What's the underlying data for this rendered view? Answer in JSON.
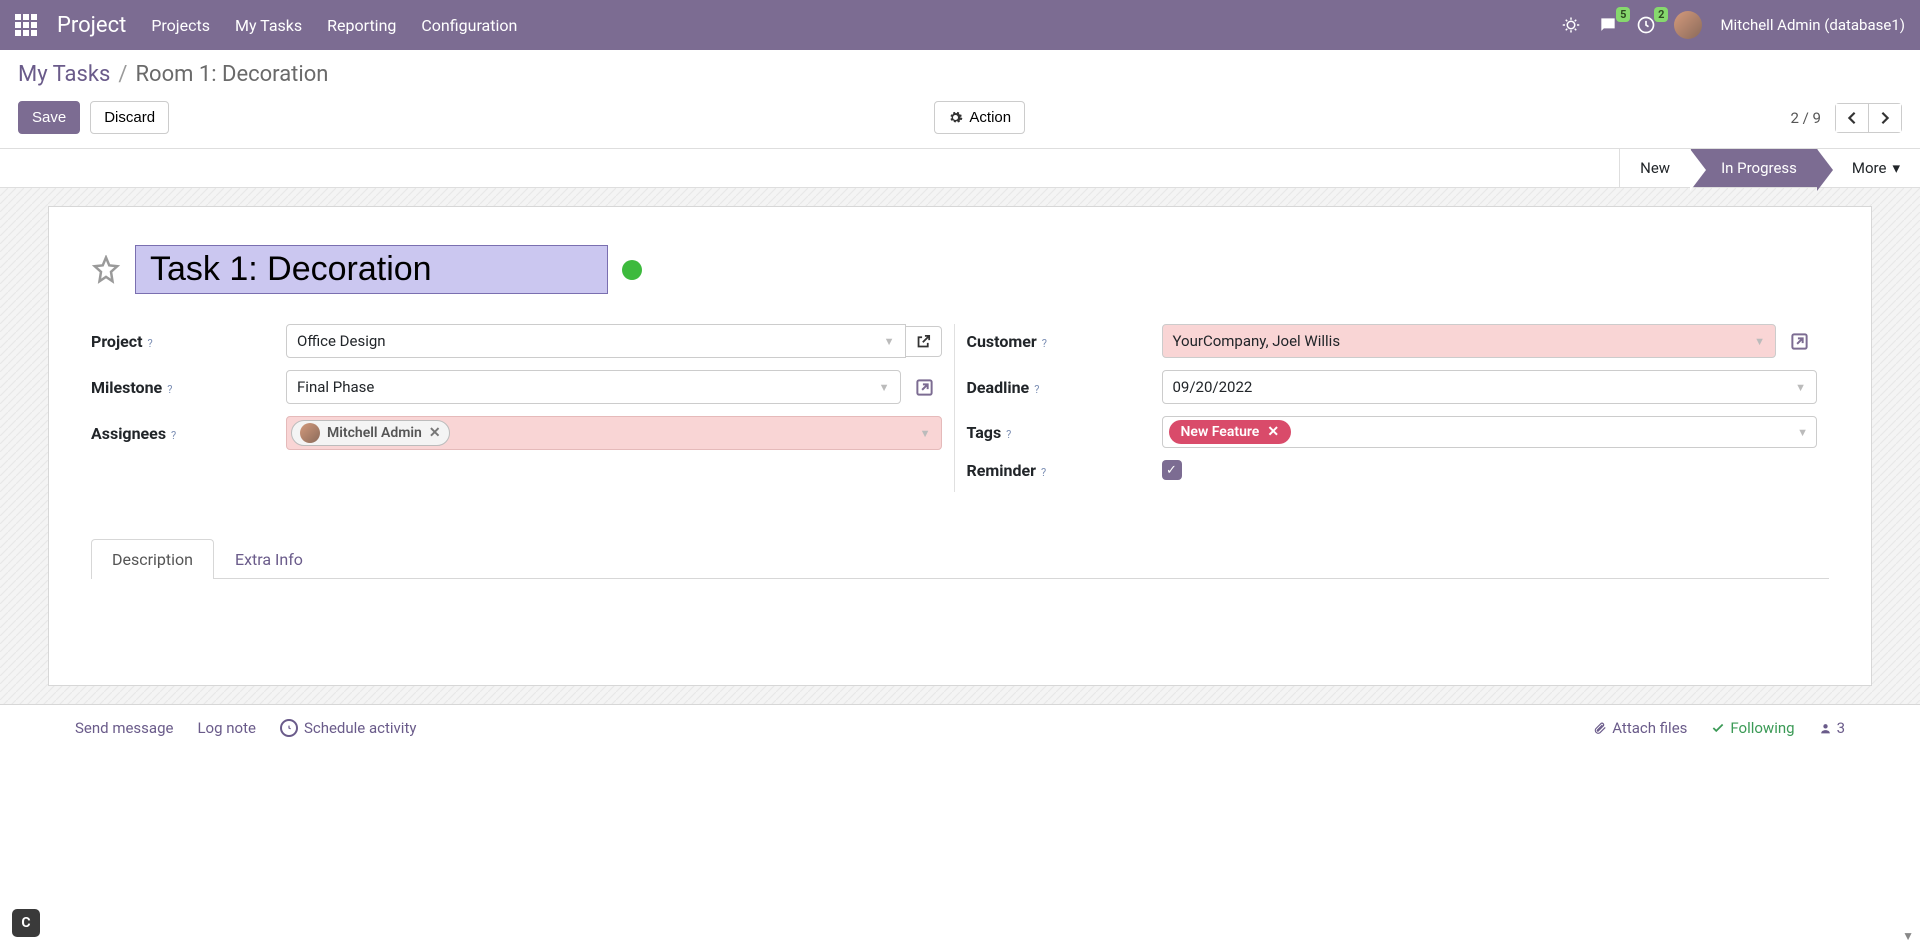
{
  "topnav": {
    "brand": "Project",
    "links": [
      "Projects",
      "My Tasks",
      "Reporting",
      "Configuration"
    ],
    "msg_badge": "5",
    "act_badge": "2",
    "user": "Mitchell Admin (database1)"
  },
  "breadcrumb": {
    "parent": "My Tasks",
    "current": "Room 1: Decoration"
  },
  "buttons": {
    "save": "Save",
    "discard": "Discard",
    "action": "Action"
  },
  "pager": {
    "text": "2 / 9"
  },
  "status": {
    "new": "New",
    "in_progress": "In Progress",
    "more": "More"
  },
  "task": {
    "title": "Task 1: Decoration"
  },
  "labels": {
    "project": "Project",
    "milestone": "Milestone",
    "assignees": "Assignees",
    "customer": "Customer",
    "deadline": "Deadline",
    "tags": "Tags",
    "reminder": "Reminder"
  },
  "fields": {
    "project": "Office Design",
    "milestone": "Final Phase",
    "assignee_name": "Mitchell Admin",
    "customer": "YourCompany, Joel Willis",
    "deadline": "09/20/2022",
    "tag": "New Feature"
  },
  "tabs": {
    "description": "Description",
    "extra_info": "Extra Info"
  },
  "chat": {
    "send": "Send message",
    "log": "Log note",
    "schedule": "Schedule activity",
    "attach": "Attach files",
    "following": "Following",
    "followers": "3"
  }
}
